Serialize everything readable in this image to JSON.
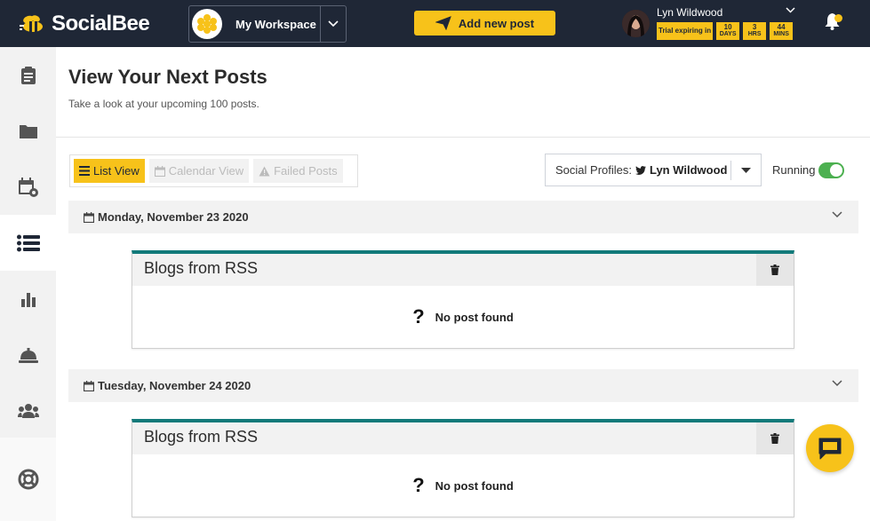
{
  "app": {
    "name": "SocialBee"
  },
  "header": {
    "workspace_label": "My Workspace",
    "add_post_label": "Add new post",
    "user_name": "Lyn Wildwood",
    "trial": {
      "label": "Trial expiring in",
      "days_value": "10",
      "days_unit": "DAYS",
      "hrs_value": "3",
      "hrs_unit": "HRS",
      "mins_value": "44",
      "mins_unit": "MINS"
    }
  },
  "page": {
    "title": "View Your Next Posts",
    "subtitle": "Take a look at your upcoming 100 posts."
  },
  "view_tabs": [
    {
      "label": "List View",
      "icon": "list-icon",
      "active": true
    },
    {
      "label": "Calendar View",
      "icon": "calendar-icon",
      "active": false
    },
    {
      "label": "Failed Posts",
      "icon": "warning-icon",
      "active": false
    }
  ],
  "filters": {
    "profiles_prefix": "Social Profiles:",
    "profiles_value": "Lyn Wildwood",
    "running_label": "Running",
    "running_on": true
  },
  "days": [
    {
      "date": "Monday, November 23 2020",
      "category": "Blogs from RSS",
      "empty_text": "No post found"
    },
    {
      "date": "Tuesday, November 24 2020",
      "category": "Blogs from RSS",
      "empty_text": "No post found"
    }
  ],
  "colors": {
    "accent": "#f7c21a",
    "topbar": "#1f2736",
    "card_border": "#127a7a",
    "toggle_on": "#4cb050"
  }
}
